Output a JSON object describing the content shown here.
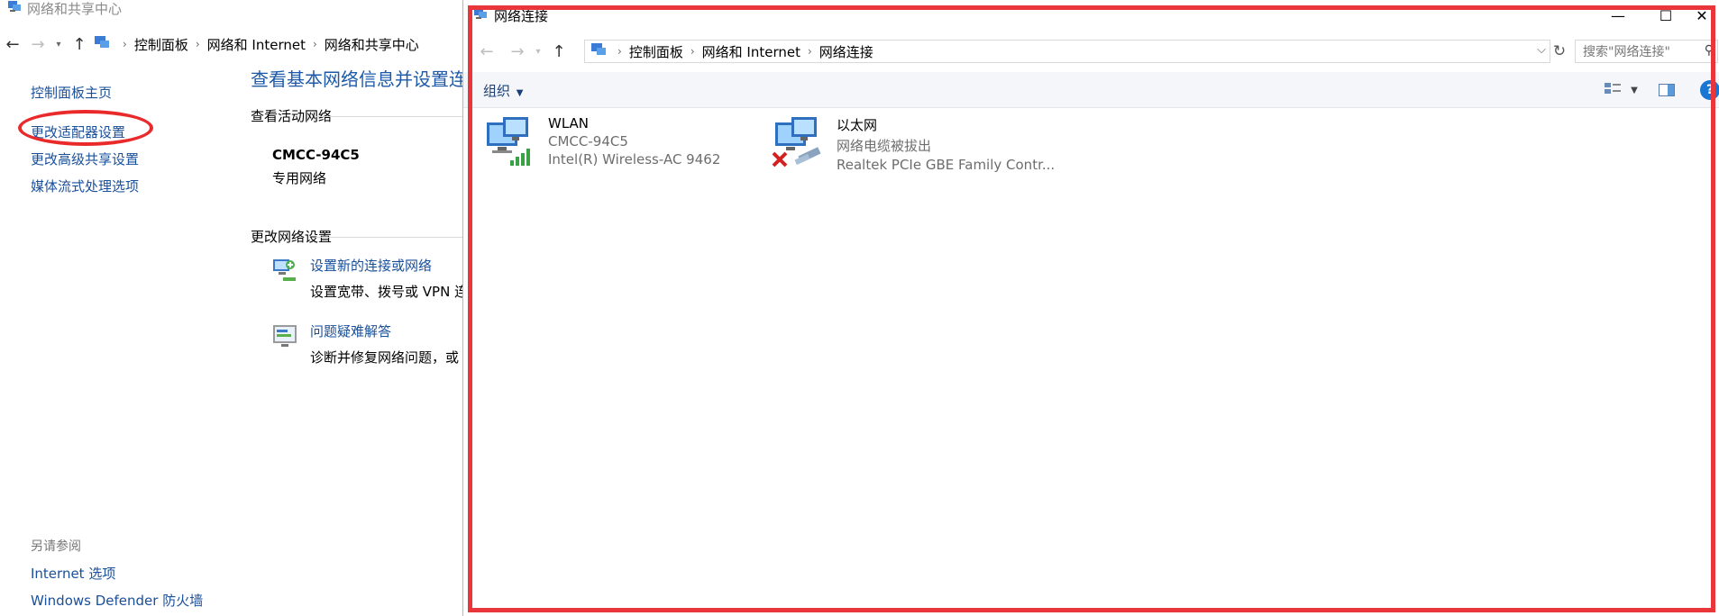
{
  "background_window": {
    "title": "网络和共享中心",
    "breadcrumb": [
      "控制面板",
      "网络和 Internet",
      "网络和共享中心"
    ],
    "left_links": {
      "home": "控制面板主页",
      "items": [
        "更改适配器设置",
        "更改高级共享设置",
        "媒体流式处理选项"
      ]
    },
    "see_also": {
      "header": "另请参阅",
      "items": [
        "Internet 选项",
        "Windows Defender 防火墙"
      ]
    },
    "main_heading": "查看基本网络信息并设置连",
    "active_networks_label": "查看活动网络",
    "network_name": "CMCC-94C5",
    "network_type": "专用网络",
    "change_settings_label": "更改网络设置",
    "tasks": [
      {
        "link": "设置新的连接或网络",
        "desc": "设置宽带、拨号或 VPN 连"
      },
      {
        "link": "问题疑难解答",
        "desc": "诊断并修复网络问题，或"
      }
    ]
  },
  "foreground_window": {
    "title": "网络连接",
    "breadcrumb": [
      "控制面板",
      "网络和 Internet",
      "网络连接"
    ],
    "search_placeholder": "搜索\"网络连接\"",
    "toolbar": {
      "organize_label": "组织"
    },
    "connections": [
      {
        "name": "WLAN",
        "status": "CMCC-94C5",
        "adapter": "Intel(R) Wireless-AC 9462"
      },
      {
        "name": "以太网",
        "status": "网络电缆被拔出",
        "adapter": "Realtek PCIe GBE Family Contr..."
      }
    ]
  },
  "colors": {
    "link": "#1a4f9a",
    "heading": "#1e5aa8",
    "highlight": "#e8363a",
    "help": "#1976d2"
  }
}
